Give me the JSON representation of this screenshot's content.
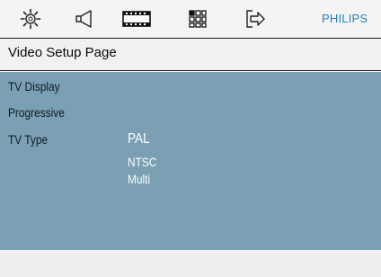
{
  "toolbar": {
    "icons": [
      "general-setup-icon",
      "audio-setup-icon",
      "video-setup-icon",
      "preference-setup-icon",
      "exit-icon"
    ],
    "brand": "PHILIPS",
    "brand_color": "#2a7fb8"
  },
  "page": {
    "title": "Video Setup Page"
  },
  "menu": {
    "items": [
      {
        "label": "TV Display"
      },
      {
        "label": "Progressive"
      },
      {
        "label": "TV Type"
      }
    ],
    "tv_type_options": [
      "PAL",
      "NTSC",
      "Multi"
    ],
    "selected_option": "PAL"
  },
  "colors": {
    "panel": "#7b9fb3",
    "background": "#f1f1f1",
    "option_text": "#ffffff"
  }
}
